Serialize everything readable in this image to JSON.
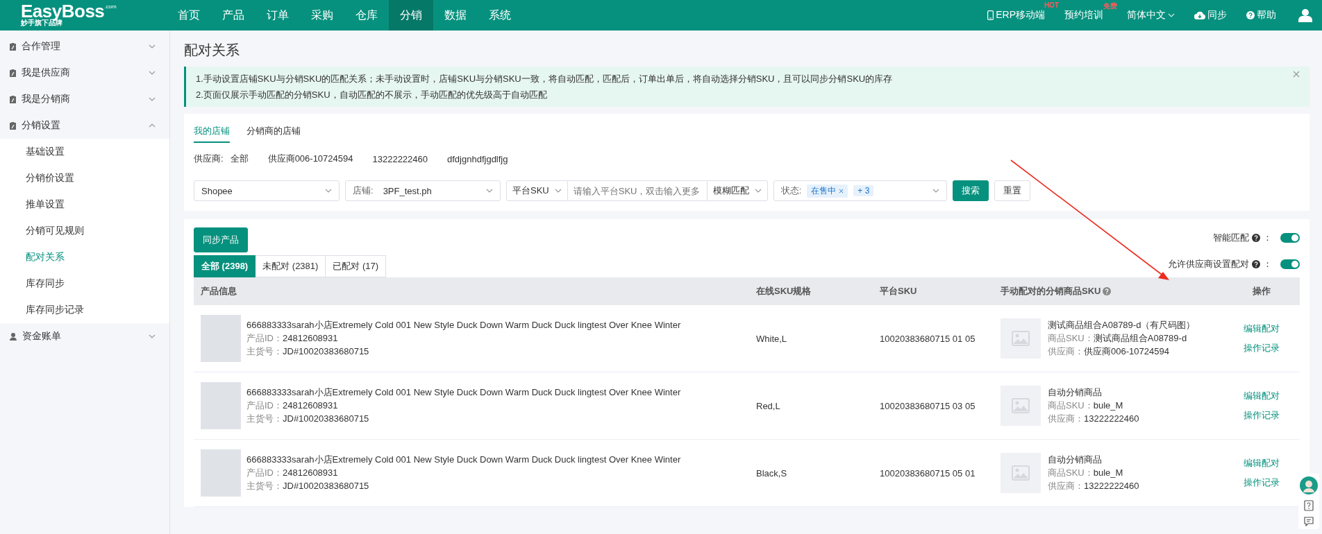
{
  "logo": {
    "name": "EasyBoss",
    "suffix": ".com",
    "tagline": "妙手旗下品牌"
  },
  "nav": [
    {
      "label": "首页",
      "selected": false
    },
    {
      "label": "产品",
      "selected": false
    },
    {
      "label": "订单",
      "selected": false
    },
    {
      "label": "采购",
      "selected": false
    },
    {
      "label": "仓库",
      "selected": false
    },
    {
      "label": "分销",
      "selected": true
    },
    {
      "label": "数据",
      "selected": false
    },
    {
      "label": "系统",
      "selected": false
    }
  ],
  "header_links": [
    {
      "kind": "mobile",
      "label": "ERP移动端",
      "badge": "HOT"
    },
    {
      "kind": "plain",
      "label": "预约培训",
      "badge": "免费"
    },
    {
      "kind": "language",
      "label": "简体中文"
    },
    {
      "kind": "sync",
      "label": "同步"
    },
    {
      "kind": "help",
      "label": "帮助"
    },
    {
      "kind": "user"
    }
  ],
  "sidebar": {
    "items": [
      {
        "kind": "clipboard",
        "label": "合作管理",
        "expanded": false
      },
      {
        "kind": "clipboard",
        "label": "我是供应商",
        "expanded": false
      },
      {
        "kind": "clipboard",
        "label": "我是分销商",
        "expanded": false
      },
      {
        "kind": "clipboard",
        "label": "分销设置",
        "expanded": true,
        "children": [
          {
            "label": "基础设置",
            "selected": false
          },
          {
            "label": "分销价设置",
            "selected": false
          },
          {
            "label": "推单设置",
            "selected": false
          },
          {
            "label": "分销可见规则",
            "selected": false
          },
          {
            "label": "配对关系",
            "selected": true
          },
          {
            "label": "库存同步",
            "selected": false
          },
          {
            "label": "库存同步记录",
            "selected": false
          }
        ]
      },
      {
        "kind": "person",
        "label": "资金账单",
        "expanded": false
      }
    ]
  },
  "page_title": "配对关系",
  "notice": {
    "lines": [
      "1.手动设置店铺SKU与分销SKU的匹配关系；未手动设置时，店铺SKU与分销SKU一致，将自动匹配，匹配后，订单出单后，将自动选择分销SKU，且可以同步分销SKU的库存",
      "2.页面仅展示手动匹配的分销SKU，自动匹配的不展示，手动匹配的优先级高于自动匹配"
    ]
  },
  "store_tabs": [
    {
      "label": "我的店铺",
      "selected": true
    },
    {
      "label": "分销商的店铺",
      "selected": false
    }
  ],
  "suppliers": {
    "label": "供应商:",
    "options": [
      "全部",
      "供应商006-10724594",
      "13222222460",
      "dfdjgnhdfjgdlfjg"
    ]
  },
  "filters": {
    "platform": "Shopee",
    "store_label": "店铺:",
    "store": "3PF_test.ph",
    "sku_type": "平台SKU",
    "sku_placeholder": "请输入平台SKU，双击输入更多",
    "match_mode": "模糊匹配",
    "status_label": "状态:",
    "status_tags": [
      "在售中"
    ],
    "status_more": "+ 3",
    "search": "搜索",
    "reset": "重置"
  },
  "sync_button": "同步产品",
  "toggles": [
    {
      "label": "智能匹配",
      "suffix": "：",
      "on": true
    },
    {
      "label": "允许供应商设置配对",
      "suffix": "：",
      "on": true
    }
  ],
  "match_tabs": [
    {
      "label": "全部 (2398)",
      "selected": true
    },
    {
      "label": "未配对 (2381)",
      "selected": false
    },
    {
      "label": "已配对 (17)",
      "selected": false
    }
  ],
  "table": {
    "columns": [
      {
        "label": "产品信息"
      },
      {
        "label": "在线SKU规格"
      },
      {
        "label": "平台SKU"
      },
      {
        "label": "手动配对的分销商品SKU",
        "help": true
      },
      {
        "label": "操作"
      }
    ],
    "rows": [
      {
        "title": "666883333sarah小店Extremely Cold 001 New Style Duck Down Warm Duck Duck lingtest Over Knee Winter",
        "id_label": "产品ID：",
        "id": "24812608931",
        "code_label": "主货号：",
        "code": "JD#10020383680715",
        "spec": "White,L",
        "platform_sku": "10020383680715 01 05",
        "match_name": "测试商品组合A08789-d（有尺码图）",
        "sku_label": "商品SKU：",
        "sku": "测试商品组合A08789-d",
        "supplier_label": "供应商：",
        "supplier": "供应商006-10724594",
        "actions": [
          "编辑配对",
          "操作记录"
        ]
      },
      {
        "title": "666883333sarah小店Extremely Cold 001 New Style Duck Down Warm Duck Duck lingtest Over Knee Winter",
        "id_label": "产品ID：",
        "id": "24812608931",
        "code_label": "主货号：",
        "code": "JD#10020383680715",
        "spec": "Red,L",
        "platform_sku": "10020383680715 03 05",
        "match_name": "自动分销商品",
        "sku_label": "商品SKU：",
        "sku": "bule_M",
        "supplier_label": "供应商：",
        "supplier": "13222222460",
        "actions": [
          "编辑配对",
          "操作记录"
        ]
      },
      {
        "title": "666883333sarah小店Extremely Cold 001 New Style Duck Down Warm Duck Duck lingtest Over Knee Winter",
        "id_label": "产品ID：",
        "id": "24812608931",
        "code_label": "主货号：",
        "code": "JD#10020383680715",
        "spec": "Black,S",
        "platform_sku": "10020383680715 05 01",
        "match_name": "自动分销商品",
        "sku_label": "商品SKU：",
        "sku": "bule_M",
        "supplier_label": "供应商：",
        "supplier": "13222222460",
        "actions": [
          "编辑配对",
          "操作记录"
        ]
      }
    ]
  }
}
